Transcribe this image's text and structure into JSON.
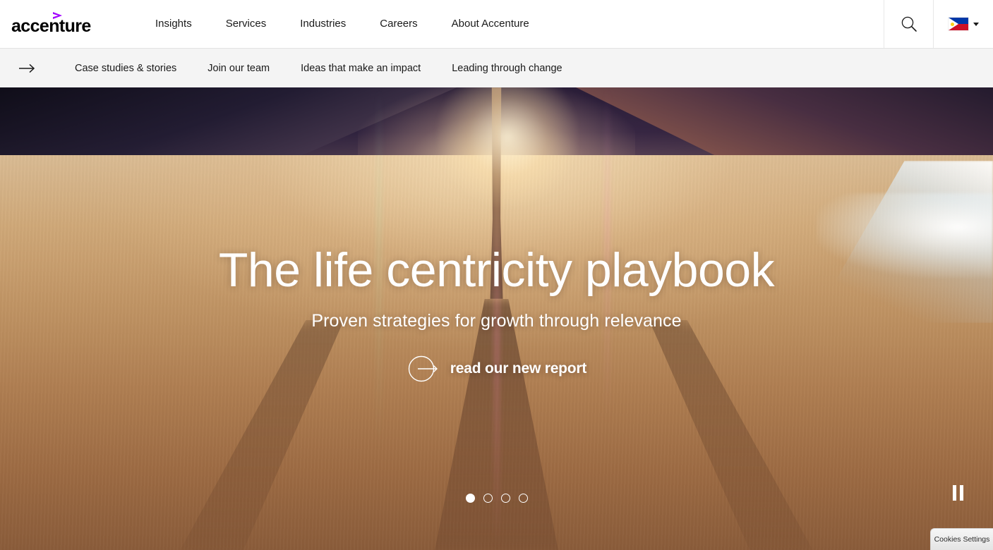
{
  "brand": {
    "name": "accenture",
    "accent_color": "#a100ff",
    "caret_icon": "greater-than-caret-icon"
  },
  "header": {
    "nav": [
      {
        "label": "Insights"
      },
      {
        "label": "Services"
      },
      {
        "label": "Industries"
      },
      {
        "label": "Careers"
      },
      {
        "label": "About Accenture"
      }
    ],
    "search_icon": "search-icon",
    "locale": {
      "country": "Philippines",
      "flag_icon": "philippines-flag-icon",
      "dropdown_icon": "chevron-down-icon"
    }
  },
  "subnav": {
    "arrow_icon": "arrow-right-icon",
    "items": [
      {
        "label": "Case studies & stories"
      },
      {
        "label": "Join our team"
      },
      {
        "label": "Ideas that make an impact"
      },
      {
        "label": "Leading through change"
      }
    ]
  },
  "hero": {
    "title": "The life centricity playbook",
    "subtitle": "Proven strategies for growth through relevance",
    "cta_label": "read our new report",
    "cta_icon": "circle-arrow-right-icon",
    "carousel": {
      "total_slides": 4,
      "active_slide": 1,
      "pause_icon": "pause-icon"
    }
  },
  "cookies": {
    "label": "Cookies Settings"
  }
}
